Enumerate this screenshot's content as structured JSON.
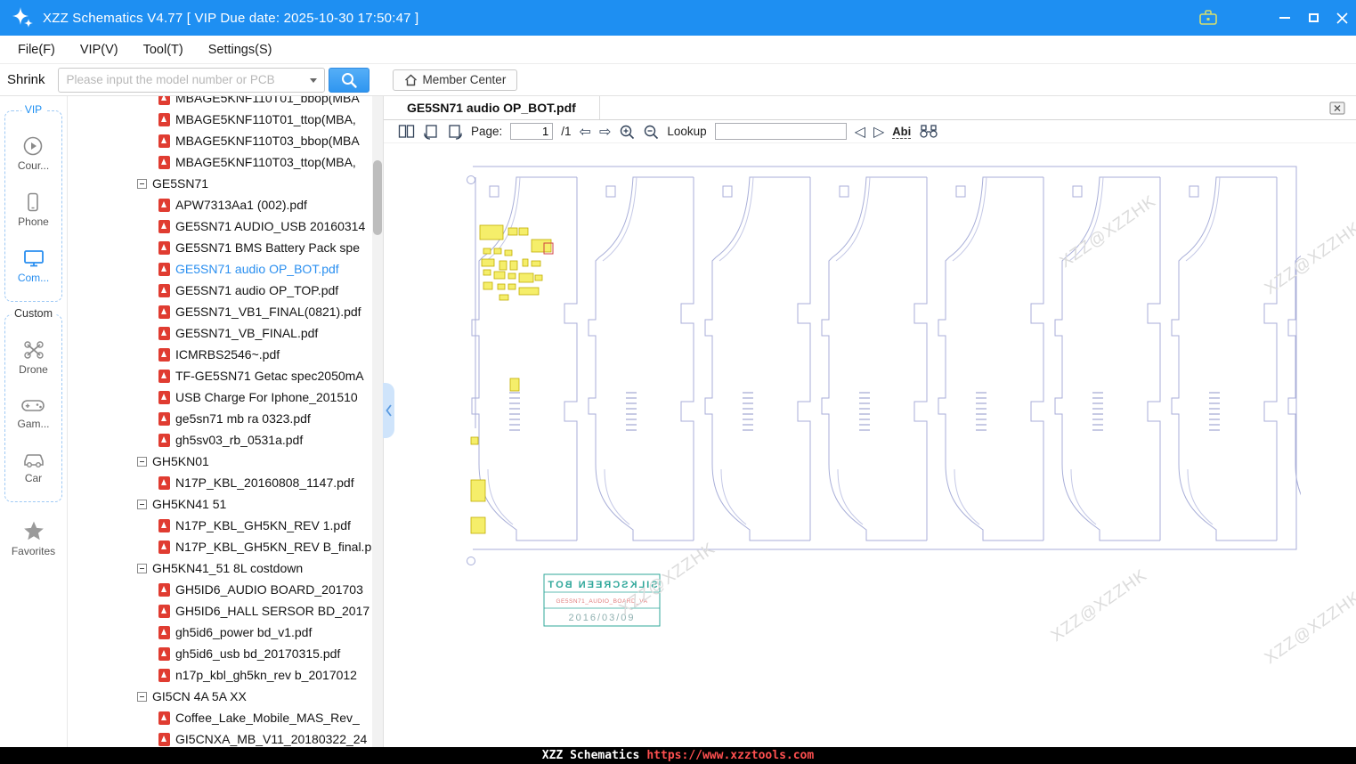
{
  "titlebar": {
    "title": "XZZ Schematics V4.77 [ VIP Due date: 2025-10-30 17:50:47 ]"
  },
  "menubar": {
    "items": [
      "File(F)",
      "VIP(V)",
      "Tool(T)",
      "Settings(S)"
    ]
  },
  "toolbar": {
    "shrink": "Shrink",
    "search_placeholder": "Please input the model number or PCB",
    "member_center": "Member Center"
  },
  "sidebar": {
    "vip_label": "VIP",
    "custom_label": "Custom",
    "items": [
      {
        "label": "Cour..."
      },
      {
        "label": "Phone"
      },
      {
        "label": "Com..."
      },
      {
        "label": "Drone"
      },
      {
        "label": "Gam..."
      },
      {
        "label": "Car"
      },
      {
        "label": "Favorites"
      }
    ]
  },
  "tree": {
    "items": [
      {
        "cls": "file",
        "label": "MBAGE5KNF110T01_bbop(MBA"
      },
      {
        "cls": "file",
        "label": "MBAGE5KNF110T01_ttop(MBA,"
      },
      {
        "cls": "file",
        "label": "MBAGE5KNF110T03_bbop(MBA"
      },
      {
        "cls": "file",
        "label": "MBAGE5KNF110T03_ttop(MBA,"
      },
      {
        "cls": "group",
        "label": "GE5SN71"
      },
      {
        "cls": "file",
        "label": "APW7313Aa1 (002).pdf"
      },
      {
        "cls": "file",
        "label": "GE5SN71 AUDIO_USB 20160314"
      },
      {
        "cls": "file",
        "label": "GE5SN71 BMS Battery Pack spe"
      },
      {
        "cls": "file sel",
        "label": "GE5SN71 audio OP_BOT.pdf"
      },
      {
        "cls": "file",
        "label": "GE5SN71 audio OP_TOP.pdf"
      },
      {
        "cls": "file",
        "label": "GE5SN71_VB1_FINAL(0821).pdf"
      },
      {
        "cls": "file",
        "label": "GE5SN71_VB_FINAL.pdf"
      },
      {
        "cls": "file",
        "label": "ICMRBS2546~.pdf"
      },
      {
        "cls": "file",
        "label": "TF-GE5SN71 Getac spec2050mA"
      },
      {
        "cls": "file",
        "label": "USB Charge For Iphone_201510"
      },
      {
        "cls": "file",
        "label": "ge5sn71 mb ra 0323.pdf"
      },
      {
        "cls": "file",
        "label": "gh5sv03_rb_0531a.pdf"
      },
      {
        "cls": "group",
        "label": "GH5KN01"
      },
      {
        "cls": "file",
        "label": "N17P_KBL_20160808_1147.pdf"
      },
      {
        "cls": "group",
        "label": "GH5KN41 51"
      },
      {
        "cls": "file",
        "label": "N17P_KBL_GH5KN_REV 1.pdf"
      },
      {
        "cls": "file",
        "label": "N17P_KBL_GH5KN_REV B_final.p"
      },
      {
        "cls": "group",
        "label": "GH5KN41_51 8L costdown"
      },
      {
        "cls": "file",
        "label": "GH5ID6_AUDIO BOARD_201703"
      },
      {
        "cls": "file",
        "label": "GH5ID6_HALL SERSOR BD_2017"
      },
      {
        "cls": "file",
        "label": "gh5id6_power bd_v1.pdf"
      },
      {
        "cls": "file",
        "label": "gh5id6_usb bd_20170315.pdf"
      },
      {
        "cls": "file",
        "label": "n17p_kbl_gh5kn_rev b_2017012"
      },
      {
        "cls": "group",
        "label": "GI5CN 4A 5A XX"
      },
      {
        "cls": "file",
        "label": "Coffee_Lake_Mobile_MAS_Rev_"
      },
      {
        "cls": "file",
        "label": "GI5CNXA_MB_V11_20180322_24"
      }
    ]
  },
  "viewer": {
    "tab_title": "GE5SN71 audio OP_BOT.pdf",
    "page_label": "Page:",
    "page_value": "1",
    "page_total": "/1",
    "lookup_label": "Lookup",
    "lookup_value": "",
    "abi_label": "Abi"
  },
  "pdf": {
    "titleblock_line1": "SILKSCREEN BOT",
    "titleblock_line2": "GE5SN71_AUDIO_BOARD_VA",
    "titleblock_line3": "2016/03/09",
    "watermark": "XZZ@XZZHK"
  },
  "icons": {
    "page_back": "⇦",
    "page_forward": "⇨",
    "find_prev": "◁",
    "find_next": "▷"
  },
  "statusbar": {
    "brand": "XZZ Schematics",
    "url": "https://www.xzztools.com"
  },
  "colors": {
    "accent": "#1e8ff2",
    "selected_blue": "#2a8ff0",
    "pdf_red": "#e03c31",
    "statusbar_url": "#ff5050",
    "outline": "#a8aed8",
    "component_yellow": "#f5ee6a",
    "titleblock_teal": "#2fa79a"
  }
}
